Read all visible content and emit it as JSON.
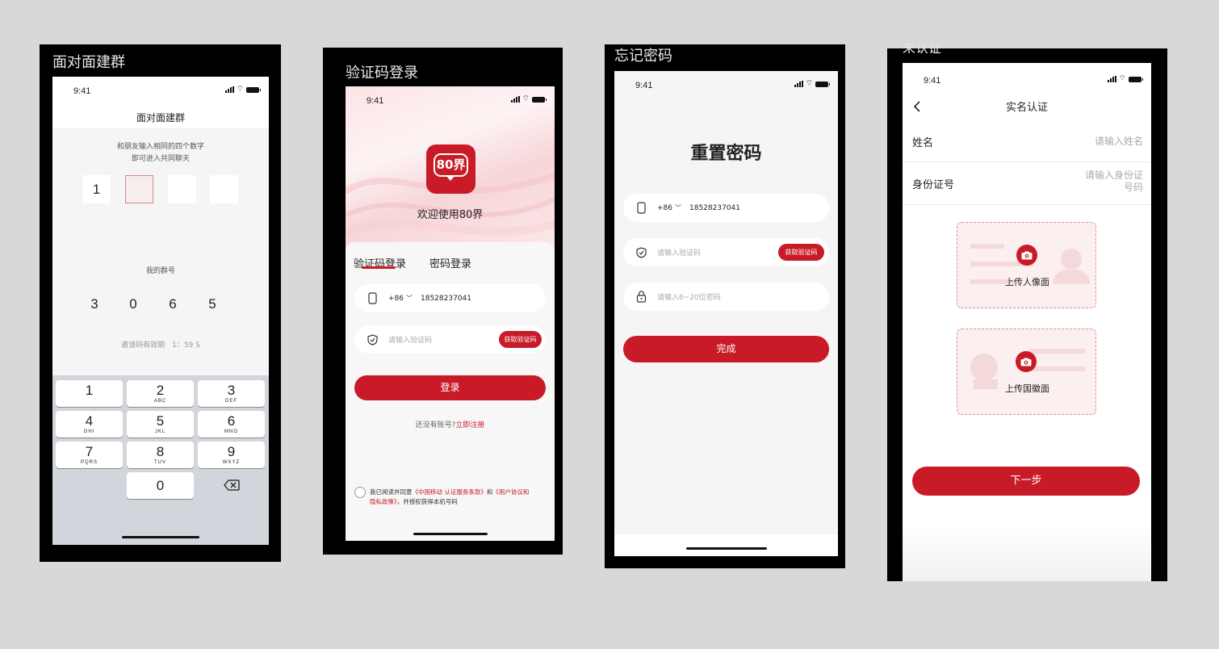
{
  "frames": [
    {
      "title": "面对面建群",
      "time": "9:41",
      "header": "面对面建群",
      "hint_line1": "和朋友输入相同的四个数字",
      "hint_line2": "即可进入共同聊天",
      "code": [
        "1",
        "",
        "",
        ""
      ],
      "group_label": "我的群号",
      "group_digits": [
        "3",
        "0",
        "6",
        "5"
      ],
      "validity": "邀请码有效期　1：59 S",
      "keys": [
        {
          "d": "1",
          "l": ""
        },
        {
          "d": "2",
          "l": "ABC"
        },
        {
          "d": "3",
          "l": "DEF"
        },
        {
          "d": "4",
          "l": "GHI"
        },
        {
          "d": "5",
          "l": "JKL"
        },
        {
          "d": "6",
          "l": "MNO"
        },
        {
          "d": "7",
          "l": "PQRS"
        },
        {
          "d": "8",
          "l": "TUV"
        },
        {
          "d": "9",
          "l": "WXYZ"
        },
        {
          "d": "0",
          "l": ""
        }
      ],
      "delete_icon": "backspace-icon"
    },
    {
      "title": "验证码登录",
      "time": "9:41",
      "logo_text": "80界",
      "welcome": "欢迎使用80界",
      "tab_sms": "验证码登录",
      "tab_password": "密码登录",
      "country_code": "+86",
      "phone": "18528237041",
      "code_placeholder": "请输入验证码",
      "get_code": "获取验证码",
      "login": "登录",
      "no_account": "还没有账号?",
      "register": "立即注册",
      "agree_prefix": "我已阅读并同意",
      "agree_link1": "《中国移动 认证服务条款》",
      "agree_and": "和",
      "agree_link2a": "《用户协议和",
      "agree_link2b": "隐私政策》",
      "agree_suffix": "，并授权获得本机号码"
    },
    {
      "title": "忘记密码",
      "time": "9:41",
      "heading": "重置密码",
      "country_code": "+86",
      "phone": "18528237041",
      "code_placeholder": "请输入验证码",
      "get_code": "获取验证码",
      "password_placeholder": "请输入6~20位密码",
      "done": "完成"
    },
    {
      "title": "未认证",
      "time": "9:41",
      "header": "实名认证",
      "name_label": "姓名",
      "name_placeholder": "请输入姓名",
      "id_label": "身份证号",
      "id_placeholder_line1": "请输入身份证",
      "id_placeholder_line2": "号码",
      "upload_portrait": "上传人像面",
      "upload_emblem": "上传国徽面",
      "next": "下一步"
    }
  ],
  "colors": {
    "brand_red": "#c81b27",
    "background": "#d8d8d8",
    "frame": "#000000"
  }
}
